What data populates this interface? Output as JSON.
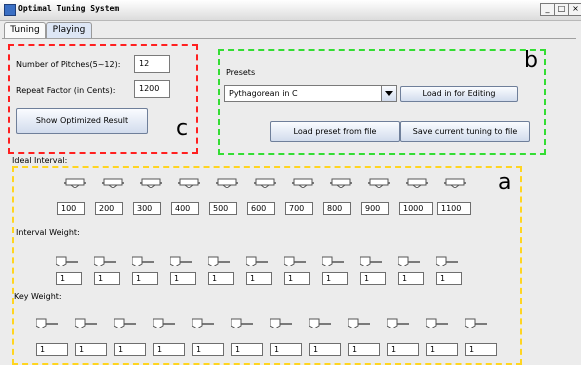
{
  "window": {
    "title": "Optimal Tuning System",
    "controls": [
      "_",
      "□",
      "×"
    ]
  },
  "tabs": [
    "Tuning",
    "Playing"
  ],
  "colors": {
    "region_c": "#ff2020",
    "region_b": "#33dd33",
    "region_a": "#ffd520"
  },
  "config": {
    "pitches_label": "Number of Pitches(5~12):",
    "pitches_value": "12",
    "repeat_label": "Repeat Factor (in Cents):",
    "repeat_value": "1200",
    "show_button": "Show Optimized Result",
    "letter": "c"
  },
  "presets": {
    "label": "Presets",
    "selected": "Pythagorean in C",
    "load_edit_button": "Load in for Editing",
    "load_file_button": "Load preset from file",
    "save_button": "Save current tuning to file",
    "letter": "b"
  },
  "sliders": {
    "letter": "a",
    "ideal_label": "Ideal Interval:",
    "ideal_values": [
      "100",
      "200",
      "300",
      "400",
      "500",
      "600",
      "700",
      "800",
      "900",
      "1000",
      "1100"
    ],
    "weight_label": "Interval Weight:",
    "weight_values": [
      "1",
      "1",
      "1",
      "1",
      "1",
      "1",
      "1",
      "1",
      "1",
      "1",
      "1"
    ],
    "key_label": "Key Weight:",
    "key_values": [
      "1",
      "1",
      "1",
      "1",
      "1",
      "1",
      "1",
      "1",
      "1",
      "1",
      "1",
      "1"
    ]
  }
}
